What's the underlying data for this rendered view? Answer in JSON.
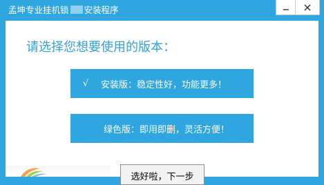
{
  "window": {
    "title_prefix": "孟坤专业挂机锁",
    "title_suffix": "安装程序"
  },
  "heading": "请选择您想要使用的版本：",
  "options": [
    {
      "check": "√",
      "label": "安装版：稳定性好，功能更多！"
    },
    {
      "label": "绿色版：即用即删，灵活方便！"
    }
  ],
  "next_button": "选好啦，下一步",
  "colors": {
    "accent": "#2fa6e0",
    "heading": "#2ea3de"
  },
  "icons": {
    "minimize": "minimize-icon",
    "close": "close-icon"
  }
}
